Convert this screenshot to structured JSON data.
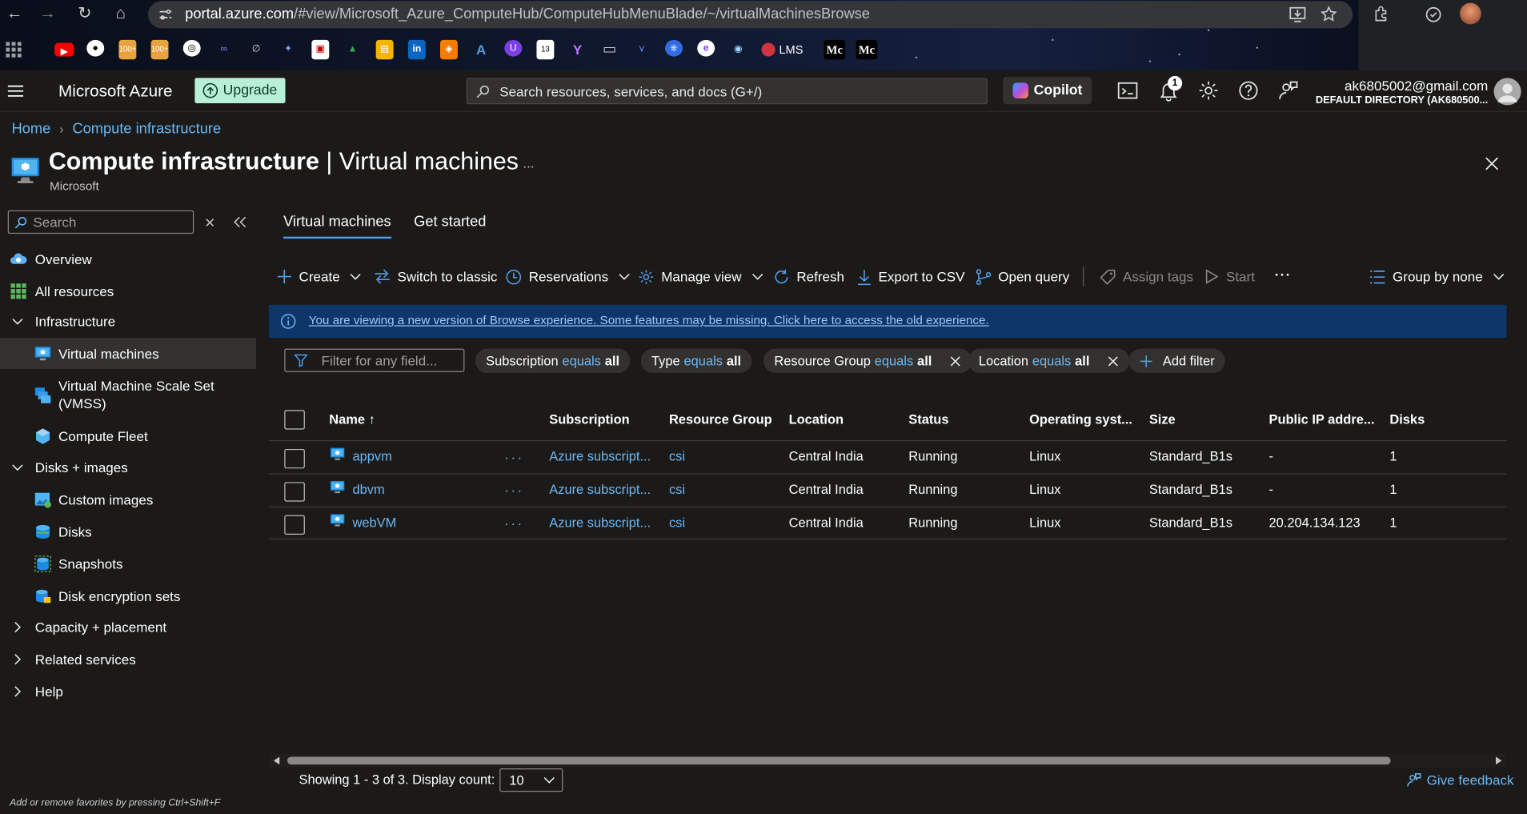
{
  "browser": {
    "url_host": "portal.azure.com",
    "url_path": "/#view/Microsoft_Azure_ComputeHub/ComputeHubMenuBlade/~/virtualMachinesBrowse",
    "bookmarks": [
      "YouTube",
      "GitHub",
      "100+",
      "100+",
      "ChatGPT",
      "",
      "",
      "Gemini",
      "",
      "Drive",
      "",
      "LinkedIn",
      "",
      "A",
      "",
      "#13",
      "Y",
      "Folder",
      "",
      "",
      "e",
      "",
      "LMS",
      "Mc",
      "Mc"
    ],
    "bookmark_lms": "LMS",
    "bookmark_mc1": "Mc",
    "bookmark_mc2": "Mc"
  },
  "topbar": {
    "brand": "Microsoft Azure",
    "upgrade_label": "Upgrade",
    "search_placeholder": "Search resources, services, and docs (G+/)",
    "copilot_label": "Copilot",
    "notification_count": "1",
    "account_email": "ak6805002@gmail.com",
    "account_directory": "DEFAULT DIRECTORY (AK680500..."
  },
  "breadcrumb": {
    "home": "Home",
    "current": "Compute infrastructure"
  },
  "page": {
    "title_main": "Compute infrastructure",
    "title_sep": " | ",
    "title_sub": "Virtual machines",
    "more": "...",
    "publisher": "Microsoft"
  },
  "sidebar": {
    "search_placeholder": "Search",
    "items": [
      {
        "label": "Overview"
      },
      {
        "label": "All resources"
      },
      {
        "label": "Infrastructure"
      },
      {
        "label": "Virtual machines"
      },
      {
        "label": "Virtual Machine Scale Set"
      },
      {
        "label": "(VMSS)"
      },
      {
        "label": "Compute Fleet"
      },
      {
        "label": "Disks + images"
      },
      {
        "label": "Custom images"
      },
      {
        "label": "Disks"
      },
      {
        "label": "Snapshots"
      },
      {
        "label": "Disk encryption sets"
      },
      {
        "label": "Capacity + placement"
      },
      {
        "label": "Related services"
      },
      {
        "label": "Help"
      }
    ],
    "favorites_hint": "Add or remove favorites by pressing Ctrl+Shift+F"
  },
  "tabs": [
    "Virtual machines",
    "Get started"
  ],
  "toolbar": {
    "create": "Create",
    "switch_classic": "Switch to classic",
    "reservations": "Reservations",
    "manage_view": "Manage view",
    "refresh": "Refresh",
    "export_csv": "Export to CSV",
    "open_query": "Open query",
    "assign_tags": "Assign tags",
    "start": "Start",
    "more": "···",
    "group_by": "Group by none"
  },
  "info_banner": "You are viewing a new version of Browse experience. Some features may be missing. Click here to access the old experience.",
  "filters": {
    "placeholder": "Filter for any field...",
    "pills": [
      {
        "field": "Subscription",
        "op": "equals",
        "value": "all"
      },
      {
        "field": "Type",
        "op": "equals",
        "value": "all"
      },
      {
        "field": "Resource Group",
        "op": "equals",
        "value": "all"
      },
      {
        "field": "Location",
        "op": "equals",
        "value": "all"
      }
    ],
    "add_filter": "Add filter"
  },
  "table": {
    "headers": [
      "Name",
      "Subscription",
      "Resource Group",
      "Location",
      "Status",
      "Operating syst...",
      "Size",
      "Public IP addre...",
      "Disks"
    ],
    "sort_indicator": "↑",
    "rows": [
      {
        "name": "appvm",
        "subscription": "Azure subscript...",
        "resource_group": "csi",
        "location": "Central India",
        "status": "Running",
        "os": "Linux",
        "size": "Standard_B1s",
        "public_ip": "-",
        "disks": "1"
      },
      {
        "name": "dbvm",
        "subscription": "Azure subscript...",
        "resource_group": "csi",
        "location": "Central India",
        "status": "Running",
        "os": "Linux",
        "size": "Standard_B1s",
        "public_ip": "-",
        "disks": "1"
      },
      {
        "name": "webVM",
        "subscription": "Azure subscript...",
        "resource_group": "csi",
        "location": "Central India",
        "status": "Running",
        "os": "Linux",
        "size": "Standard_B1s",
        "public_ip": "20.204.134.123",
        "disks": "1"
      }
    ],
    "row_menu": "···"
  },
  "footer": {
    "showing": "Showing 1 - 3 of 3. Display count:",
    "display_count": "10",
    "feedback": "Give feedback"
  },
  "colors": {
    "accent": "#4f9eea",
    "link": "#6cb8f6",
    "background": "#1b1a19",
    "info_banner": "#0f3668",
    "upgrade": "#b7f0d7"
  }
}
